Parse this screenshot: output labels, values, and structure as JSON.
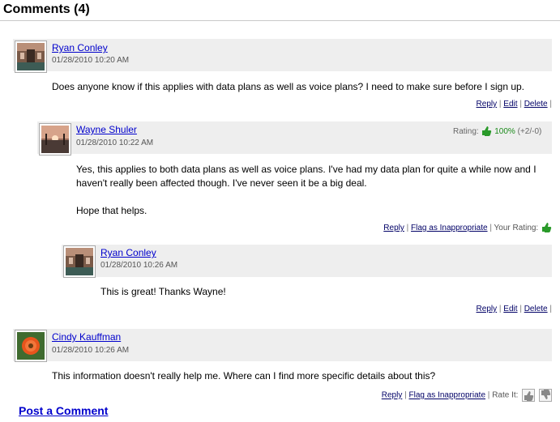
{
  "header": {
    "title": "Comments (4)"
  },
  "comments": [
    {
      "author": "Ryan Conley",
      "date": "01/28/2010 10:20 AM",
      "body": [
        "Does anyone know if this applies with data plans as well as voice plans? I need to make sure before I sign up."
      ],
      "actions": {
        "reply": "Reply",
        "edit": "Edit",
        "delete": "Delete"
      }
    },
    {
      "author": "Wayne Shuler",
      "date": "01/28/2010 10:22 AM",
      "rating": {
        "label": "Rating:",
        "percent": "100%",
        "count": "(+2/-0)"
      },
      "body": [
        "Yes, this applies to both data plans as well as voice plans. I've had my data plan for quite a while now and I",
        "haven't really been affected though. I've never seen it be a big deal.",
        "Hope that helps."
      ],
      "actions": {
        "reply": "Reply",
        "flag": "Flag as Inappropriate",
        "your_rating": "Your Rating:"
      }
    },
    {
      "author": "Ryan Conley",
      "date": "01/28/2010 10:26 AM",
      "body": [
        "This is great! Thanks Wayne!"
      ],
      "actions": {
        "reply": "Reply",
        "edit": "Edit",
        "delete": "Delete"
      }
    },
    {
      "author": "Cindy Kauffman",
      "date": "01/28/2010 10:26 AM",
      "body": [
        "This information doesn't really help me. Where can I find more specific details about this?"
      ],
      "actions": {
        "reply": "Reply",
        "flag": "Flag as Inappropriate",
        "rate_it": "Rate It:"
      }
    }
  ],
  "footer": {
    "post_comment": "Post a Comment"
  },
  "colors": {
    "link": "#0000cc",
    "bar": "#eeeeee",
    "rating_green": "#1a8a1a"
  }
}
